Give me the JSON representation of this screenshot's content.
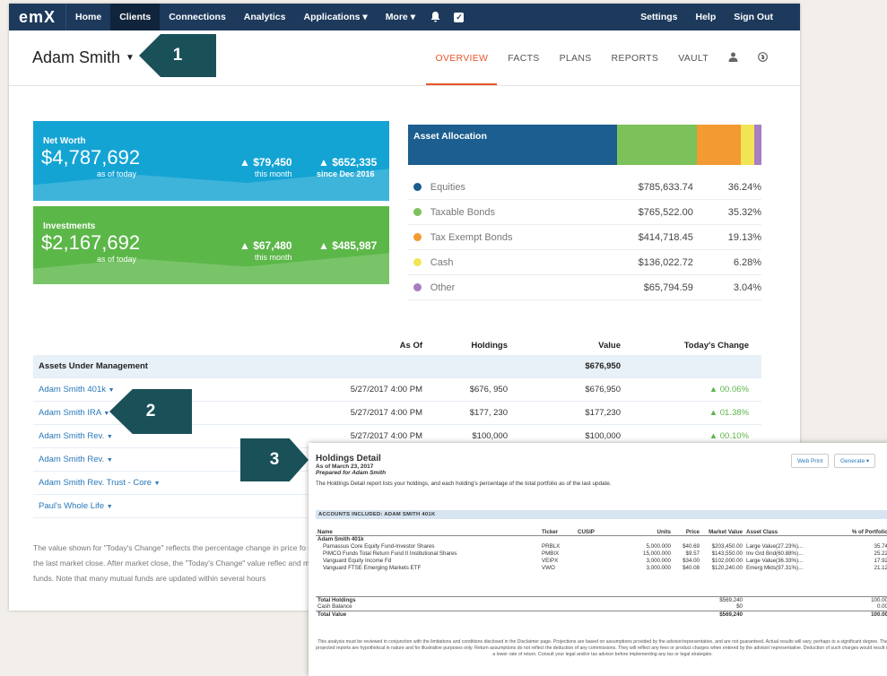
{
  "nav": {
    "logo": "emX",
    "items": [
      "Home",
      "Clients",
      "Connections",
      "Analytics",
      "Applications ▾",
      "More ▾"
    ],
    "right": [
      "Settings",
      "Help",
      "Sign Out"
    ]
  },
  "client": {
    "name": "Adam Smith"
  },
  "tabs": [
    "OVERVIEW",
    "FACTS",
    "PLANS",
    "REPORTS",
    "VAULT"
  ],
  "net_worth": {
    "title": "Net Worth",
    "value": "$4,787,692",
    "as_of": "as of today",
    "month_change": "▲ $79,450",
    "month_label": "this month",
    "since_change": "▲ $652,335",
    "since_label": "since Dec 2016"
  },
  "investments": {
    "title": "Investments",
    "value": "$2,167,692",
    "as_of": "as of today",
    "month_change": "▲ $67,480",
    "month_label": "this month",
    "since_change": "▲ $485,987"
  },
  "allocation": {
    "title": "Asset Allocation",
    "items": [
      {
        "name": "Equities",
        "value": "$785,633.74",
        "pct": "36.24%",
        "color": "#1b5e8f",
        "share": 36.24
      },
      {
        "name": "Taxable Bonds",
        "value": "$765,522.00",
        "pct": "35.32%",
        "color": "#7dc15b",
        "share": 35.32
      },
      {
        "name": "Tax Exempt Bonds",
        "value": "$414,718.45",
        "pct": "19.13%",
        "color": "#f39a32",
        "share": 19.13
      },
      {
        "name": "Cash",
        "value": "$136,022.72",
        "pct": "6.28%",
        "color": "#f2e553",
        "share": 6.28
      },
      {
        "name": "Other",
        "value": "$65,794.59",
        "pct": "3.04%",
        "color": "#a77ec2",
        "share": 3.04
      }
    ]
  },
  "aum": {
    "headers": [
      "As Of",
      "Holdings",
      "Value",
      "Today's Change"
    ],
    "section": "Assets Under Management",
    "section_value": "$676,950",
    "rows": [
      {
        "name": "Adam Smith 401k",
        "as_of": "5/27/2017 4:00 PM",
        "holdings": "$676, 950",
        "value": "$676,950",
        "change": "▲ 00.06%"
      },
      {
        "name": "Adam Smith IRA",
        "as_of": "5/27/2017 4:00 PM",
        "holdings": "$177, 230",
        "value": "$177,230",
        "change": "▲ 01.38%"
      },
      {
        "name": "Adam Smith Rev.",
        "as_of": "5/27/2017 4:00 PM",
        "holdings": "$100,000",
        "value": "$100,000",
        "change": "▲ 00.10%"
      },
      {
        "name": "Adam Smith Rev.",
        "as_of": "",
        "holdings": "",
        "value": "",
        "change": ""
      },
      {
        "name": "Adam Smith Rev. Trust - Core",
        "as_of": "",
        "holdings": "",
        "value": "",
        "change": ""
      },
      {
        "name": "Paul's Whole Life",
        "as_of": "",
        "holdings": "",
        "value": "",
        "change": ""
      }
    ]
  },
  "note": "The value shown for \"Today's Change\" reflects the percentage change in price fo since the last market close. After market close, the \"Today's Change\" value reflec and mutual funds. Note that many mutual funds are updated within several hours",
  "callouts": [
    "1",
    "2",
    "3"
  ],
  "holdings": {
    "title": "Holdings Detail",
    "as_of": "As of March 23, 2017",
    "prepared": "Prepared for Adam Smith",
    "desc": "The Holdings Detail report lists your holdings, and each holding's percentage of the total portfolio as of the last update.",
    "web_print": "Web Print",
    "generate": "Generate ▾",
    "accounts_label": "ACCOUNTS INCLUDED: ADAM SMITH 401K",
    "columns": [
      "Name",
      "Ticker",
      "CUSIP",
      "Units",
      "Price",
      "Market Value",
      "Asset Class",
      "% of Portfolio"
    ],
    "group": "Adam Smith 401k",
    "rows": [
      {
        "name": "Parnassus Core Equity Fund-Investor Shares",
        "ticker": "PRBLX",
        "cusip": "",
        "units": "5,000.000",
        "price": "$40.69",
        "mv": "$203,450.00",
        "cls": "Large Value(27.23%)...",
        "pct": "35.74"
      },
      {
        "name": "PIMCO Funds Total Return Fund II Institutional Shares",
        "ticker": "PMBIX",
        "cusip": "",
        "units": "15,000.000",
        "price": "$9.57",
        "mv": "$143,550.00",
        "cls": "Inv Grd Bnd(60.88%)...",
        "pct": "25.22"
      },
      {
        "name": "Vanguard Equity Income Fd",
        "ticker": "VEIPX",
        "cusip": "",
        "units": "3,000.000",
        "price": "$34.00",
        "mv": "$102,000.00",
        "cls": "Large Value(36.33%)...",
        "pct": "17.92"
      },
      {
        "name": "Vanguard FTSE Emerging Markets ETF",
        "ticker": "VWO",
        "cusip": "",
        "units": "3,000.000",
        "price": "$40.08",
        "mv": "$120,240.00",
        "cls": "Emerg Mkts(97.31%)...",
        "pct": "21.12"
      }
    ],
    "totals": [
      {
        "label": "Total Holdings",
        "mv": "$569,240",
        "pct": "100.00"
      },
      {
        "label": "Cash Balance",
        "mv": "$0",
        "pct": "0.00"
      },
      {
        "label": "Total Value",
        "mv": "$569,240",
        "pct": "100.00"
      }
    ],
    "disclaimer": "This analysis must be reviewed in conjunction with the limitations and conditions disclosed in the Disclaimer page. Projections are based on assumptions provided by the advisor/representative, and are not guaranteed. Actual results will vary, perhaps to a significant degree. The projected reports are hypothetical in nature and for illustrative purposes only. Return assumptions do not reflect the deduction of any commissions. They will reflect any fees or product charges when entered by the advisor/ representative. Deduction of such charges would result in a lower rate of return. Consult your legal and/or tax advisor before implementing any tax or legal strategies."
  }
}
